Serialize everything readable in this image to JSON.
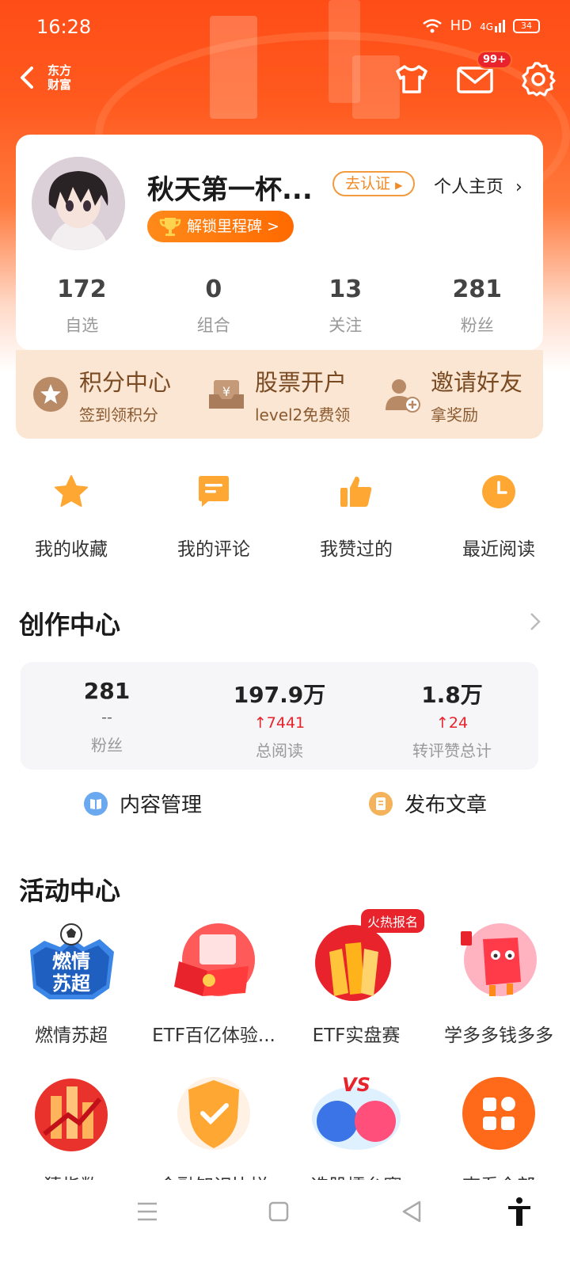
{
  "status_bar": {
    "time": "16:28",
    "network": "HD",
    "signal": "4G",
    "battery": "34"
  },
  "header": {
    "logo_line1": "东方",
    "logo_line2": "财富",
    "mail_badge": "99+"
  },
  "profile": {
    "username": "秋天第一杯...",
    "cert_label": "去认证",
    "homepage_label": "个人主页",
    "milestone_label": "解锁里程碑 >",
    "stats": [
      {
        "value": "172",
        "label": "自选"
      },
      {
        "value": "0",
        "label": "组合"
      },
      {
        "value": "13",
        "label": "关注"
      },
      {
        "value": "281",
        "label": "粉丝"
      }
    ]
  },
  "promo": [
    {
      "title": "积分中心",
      "subtitle": "签到领积分",
      "icon": "star-coin-icon"
    },
    {
      "title": "股票开户",
      "subtitle": "level2免费领",
      "icon": "yuan-box-icon"
    },
    {
      "title": "邀请好友",
      "subtitle": "拿奖励",
      "icon": "add-user-icon"
    }
  ],
  "quick_actions": [
    {
      "label": "我的收藏",
      "icon": "star-icon"
    },
    {
      "label": "我的评论",
      "icon": "comment-icon"
    },
    {
      "label": "我赞过的",
      "icon": "thumbs-up-icon"
    },
    {
      "label": "最近阅读",
      "icon": "clock-icon"
    }
  ],
  "creator_center": {
    "title": "创作中心",
    "stats": [
      {
        "value": "281",
        "delta": "--",
        "label": "粉丝"
      },
      {
        "value": "197.9万",
        "delta": "7441",
        "label": "总阅读"
      },
      {
        "value": "1.8万",
        "delta": "24",
        "label": "转评赞总计"
      }
    ],
    "actions": [
      {
        "label": "内容管理",
        "icon": "book-icon"
      },
      {
        "label": "发布文章",
        "icon": "document-icon"
      }
    ]
  },
  "activity_center": {
    "title": "活动中心",
    "row1": [
      {
        "label": "燃情苏超",
        "art_text_top": "燃情",
        "art_text_bottom": "苏超"
      },
      {
        "label": "ETF百亿体验..."
      },
      {
        "label": "ETF实盘赛",
        "tag": "火热报名"
      },
      {
        "label": "学多多钱多多"
      }
    ],
    "row2": [
      {
        "label": "猜指数"
      },
      {
        "label": "金融知识比拼"
      },
      {
        "label": "选股擂台赛",
        "art_text": "VS"
      },
      {
        "label": "查看全部"
      }
    ]
  },
  "colors": {
    "brand": "#ff5a1f",
    "accent": "#ff8a1a",
    "up_red": "#e8232b"
  }
}
